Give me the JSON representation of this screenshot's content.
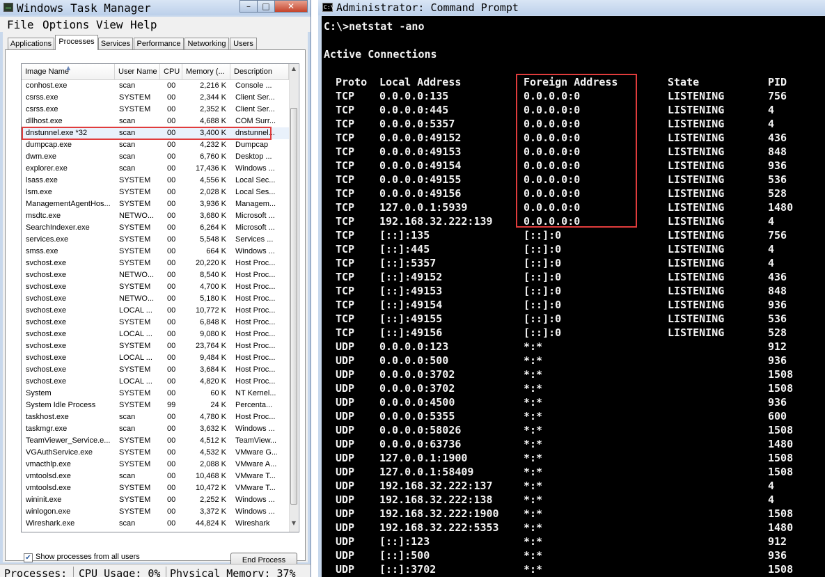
{
  "task_manager": {
    "title": "Windows Task Manager",
    "menu": [
      "File",
      "Options",
      "View",
      "Help"
    ],
    "tabs": [
      "Applications",
      "Processes",
      "Services",
      "Performance",
      "Networking",
      "Users"
    ],
    "active_tab": "Processes",
    "columns": [
      "Image Name",
      "User Name",
      "CPU",
      "Memory (...",
      "Description"
    ],
    "processes": [
      {
        "name": "conhost.exe",
        "user": "scan",
        "cpu": "00",
        "mem": "2,216 K",
        "desc": "Console ..."
      },
      {
        "name": "csrss.exe",
        "user": "SYSTEM",
        "cpu": "00",
        "mem": "2,344 K",
        "desc": "Client Ser..."
      },
      {
        "name": "csrss.exe",
        "user": "SYSTEM",
        "cpu": "00",
        "mem": "2,352 K",
        "desc": "Client Ser..."
      },
      {
        "name": "dllhost.exe",
        "user": "scan",
        "cpu": "00",
        "mem": "4,688 K",
        "desc": "COM Surr..."
      },
      {
        "name": "dnstunnel.exe *32",
        "user": "scan",
        "cpu": "00",
        "mem": "3,400 K",
        "desc": "dnstunnel..."
      },
      {
        "name": "dumpcap.exe",
        "user": "scan",
        "cpu": "00",
        "mem": "4,232 K",
        "desc": "Dumpcap"
      },
      {
        "name": "dwm.exe",
        "user": "scan",
        "cpu": "00",
        "mem": "6,760 K",
        "desc": "Desktop ..."
      },
      {
        "name": "explorer.exe",
        "user": "scan",
        "cpu": "00",
        "mem": "17,436 K",
        "desc": "Windows ..."
      },
      {
        "name": "lsass.exe",
        "user": "SYSTEM",
        "cpu": "00",
        "mem": "4,556 K",
        "desc": "Local Sec..."
      },
      {
        "name": "lsm.exe",
        "user": "SYSTEM",
        "cpu": "00",
        "mem": "2,028 K",
        "desc": "Local Ses..."
      },
      {
        "name": "ManagementAgentHos...",
        "user": "SYSTEM",
        "cpu": "00",
        "mem": "3,936 K",
        "desc": "Managem..."
      },
      {
        "name": "msdtc.exe",
        "user": "NETWO...",
        "cpu": "00",
        "mem": "3,680 K",
        "desc": "Microsoft ..."
      },
      {
        "name": "SearchIndexer.exe",
        "user": "SYSTEM",
        "cpu": "00",
        "mem": "6,264 K",
        "desc": "Microsoft ..."
      },
      {
        "name": "services.exe",
        "user": "SYSTEM",
        "cpu": "00",
        "mem": "5,548 K",
        "desc": "Services ..."
      },
      {
        "name": "smss.exe",
        "user": "SYSTEM",
        "cpu": "00",
        "mem": "664 K",
        "desc": "Windows ..."
      },
      {
        "name": "svchost.exe",
        "user": "SYSTEM",
        "cpu": "00",
        "mem": "20,220 K",
        "desc": "Host Proc..."
      },
      {
        "name": "svchost.exe",
        "user": "NETWO...",
        "cpu": "00",
        "mem": "8,540 K",
        "desc": "Host Proc..."
      },
      {
        "name": "svchost.exe",
        "user": "SYSTEM",
        "cpu": "00",
        "mem": "4,700 K",
        "desc": "Host Proc..."
      },
      {
        "name": "svchost.exe",
        "user": "NETWO...",
        "cpu": "00",
        "mem": "5,180 K",
        "desc": "Host Proc..."
      },
      {
        "name": "svchost.exe",
        "user": "LOCAL ...",
        "cpu": "00",
        "mem": "10,772 K",
        "desc": "Host Proc..."
      },
      {
        "name": "svchost.exe",
        "user": "SYSTEM",
        "cpu": "00",
        "mem": "6,848 K",
        "desc": "Host Proc..."
      },
      {
        "name": "svchost.exe",
        "user": "LOCAL ...",
        "cpu": "00",
        "mem": "9,080 K",
        "desc": "Host Proc..."
      },
      {
        "name": "svchost.exe",
        "user": "SYSTEM",
        "cpu": "00",
        "mem": "23,764 K",
        "desc": "Host Proc..."
      },
      {
        "name": "svchost.exe",
        "user": "LOCAL ...",
        "cpu": "00",
        "mem": "9,484 K",
        "desc": "Host Proc..."
      },
      {
        "name": "svchost.exe",
        "user": "SYSTEM",
        "cpu": "00",
        "mem": "3,684 K",
        "desc": "Host Proc..."
      },
      {
        "name": "svchost.exe",
        "user": "LOCAL ...",
        "cpu": "00",
        "mem": "4,820 K",
        "desc": "Host Proc..."
      },
      {
        "name": "System",
        "user": "SYSTEM",
        "cpu": "00",
        "mem": "60 K",
        "desc": "NT Kernel..."
      },
      {
        "name": "System Idle Process",
        "user": "SYSTEM",
        "cpu": "99",
        "mem": "24 K",
        "desc": "Percenta..."
      },
      {
        "name": "taskhost.exe",
        "user": "scan",
        "cpu": "00",
        "mem": "4,780 K",
        "desc": "Host Proc..."
      },
      {
        "name": "taskmgr.exe",
        "user": "scan",
        "cpu": "00",
        "mem": "3,632 K",
        "desc": "Windows ..."
      },
      {
        "name": "TeamViewer_Service.e...",
        "user": "SYSTEM",
        "cpu": "00",
        "mem": "4,512 K",
        "desc": "TeamView..."
      },
      {
        "name": "VGAuthService.exe",
        "user": "SYSTEM",
        "cpu": "00",
        "mem": "4,532 K",
        "desc": "VMware G..."
      },
      {
        "name": "vmacthlp.exe",
        "user": "SYSTEM",
        "cpu": "00",
        "mem": "2,088 K",
        "desc": "VMware A..."
      },
      {
        "name": "vmtoolsd.exe",
        "user": "scan",
        "cpu": "00",
        "mem": "10,468 K",
        "desc": "VMware T..."
      },
      {
        "name": "vmtoolsd.exe",
        "user": "SYSTEM",
        "cpu": "00",
        "mem": "10,472 K",
        "desc": "VMware T..."
      },
      {
        "name": "wininit.exe",
        "user": "SYSTEM",
        "cpu": "00",
        "mem": "2,252 K",
        "desc": "Windows ..."
      },
      {
        "name": "winlogon.exe",
        "user": "SYSTEM",
        "cpu": "00",
        "mem": "3,372 K",
        "desc": "Windows ..."
      },
      {
        "name": "Wireshark.exe",
        "user": "scan",
        "cpu": "00",
        "mem": "44,824 K",
        "desc": "Wireshark"
      }
    ],
    "show_all_label": "Show processes from all users",
    "show_all_checked": true,
    "end_process_label": "End Process",
    "status": {
      "processes": "Processes:",
      "cpu": "CPU Usage: 0%",
      "memory": "Physical Memory: 37%"
    },
    "highlight_color": "#e03c3c"
  },
  "cmd": {
    "title": "Administrator: Command Prompt",
    "icon_text": "C:\\",
    "command_line": "C:\\>netstat -ano",
    "section_title": "Active Connections",
    "headers": {
      "proto": "Proto",
      "local": "Local Address",
      "foreign": "Foreign Address",
      "state": "State",
      "pid": "PID"
    },
    "rows": [
      [
        "TCP",
        "0.0.0.0:135",
        "0.0.0.0:0",
        "LISTENING",
        "756"
      ],
      [
        "TCP",
        "0.0.0.0:445",
        "0.0.0.0:0",
        "LISTENING",
        "4"
      ],
      [
        "TCP",
        "0.0.0.0:5357",
        "0.0.0.0:0",
        "LISTENING",
        "4"
      ],
      [
        "TCP",
        "0.0.0.0:49152",
        "0.0.0.0:0",
        "LISTENING",
        "436"
      ],
      [
        "TCP",
        "0.0.0.0:49153",
        "0.0.0.0:0",
        "LISTENING",
        "848"
      ],
      [
        "TCP",
        "0.0.0.0:49154",
        "0.0.0.0:0",
        "LISTENING",
        "936"
      ],
      [
        "TCP",
        "0.0.0.0:49155",
        "0.0.0.0:0",
        "LISTENING",
        "536"
      ],
      [
        "TCP",
        "0.0.0.0:49156",
        "0.0.0.0:0",
        "LISTENING",
        "528"
      ],
      [
        "TCP",
        "127.0.0.1:5939",
        "0.0.0.0:0",
        "LISTENING",
        "1480"
      ],
      [
        "TCP",
        "192.168.32.222:139",
        "0.0.0.0:0",
        "LISTENING",
        "4"
      ],
      [
        "TCP",
        "[::]:135",
        "[::]:0",
        "LISTENING",
        "756"
      ],
      [
        "TCP",
        "[::]:445",
        "[::]:0",
        "LISTENING",
        "4"
      ],
      [
        "TCP",
        "[::]:5357",
        "[::]:0",
        "LISTENING",
        "4"
      ],
      [
        "TCP",
        "[::]:49152",
        "[::]:0",
        "LISTENING",
        "436"
      ],
      [
        "TCP",
        "[::]:49153",
        "[::]:0",
        "LISTENING",
        "848"
      ],
      [
        "TCP",
        "[::]:49154",
        "[::]:0",
        "LISTENING",
        "936"
      ],
      [
        "TCP",
        "[::]:49155",
        "[::]:0",
        "LISTENING",
        "536"
      ],
      [
        "TCP",
        "[::]:49156",
        "[::]:0",
        "LISTENING",
        "528"
      ],
      [
        "UDP",
        "0.0.0.0:123",
        "*:*",
        "",
        "912"
      ],
      [
        "UDP",
        "0.0.0.0:500",
        "*:*",
        "",
        "936"
      ],
      [
        "UDP",
        "0.0.0.0:3702",
        "*:*",
        "",
        "1508"
      ],
      [
        "UDP",
        "0.0.0.0:3702",
        "*:*",
        "",
        "1508"
      ],
      [
        "UDP",
        "0.0.0.0:4500",
        "*:*",
        "",
        "936"
      ],
      [
        "UDP",
        "0.0.0.0:5355",
        "*:*",
        "",
        "600"
      ],
      [
        "UDP",
        "0.0.0.0:58026",
        "*:*",
        "",
        "1508"
      ],
      [
        "UDP",
        "0.0.0.0:63736",
        "*:*",
        "",
        "1480"
      ],
      [
        "UDP",
        "127.0.0.1:1900",
        "*:*",
        "",
        "1508"
      ],
      [
        "UDP",
        "127.0.0.1:58409",
        "*:*",
        "",
        "1508"
      ],
      [
        "UDP",
        "192.168.32.222:137",
        "*:*",
        "",
        "4"
      ],
      [
        "UDP",
        "192.168.32.222:138",
        "*:*",
        "",
        "4"
      ],
      [
        "UDP",
        "192.168.32.222:1900",
        "*:*",
        "",
        "1508"
      ],
      [
        "UDP",
        "192.168.32.222:5353",
        "*:*",
        "",
        "1480"
      ],
      [
        "UDP",
        "[::]:123",
        "*:*",
        "",
        "912"
      ],
      [
        "UDP",
        "[::]:500",
        "*:*",
        "",
        "936"
      ],
      [
        "UDP",
        "[::]:3702",
        "*:*",
        "",
        "1508"
      ]
    ],
    "background_color": "#000000",
    "text_color": "#f2f2f2",
    "highlight_color": "#e03c3c"
  }
}
